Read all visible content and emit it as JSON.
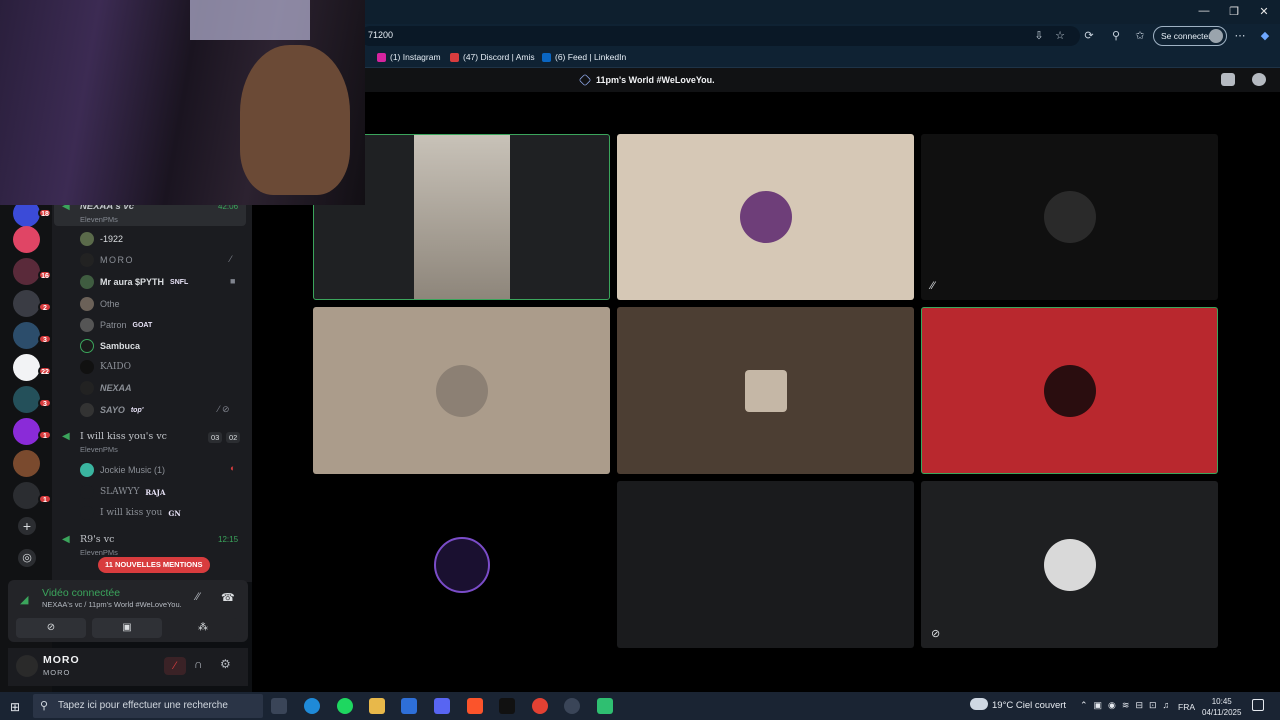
{
  "browser": {
    "url_fragment": "71200",
    "sign_in": "Se connecter",
    "bookmarks": [
      {
        "label": "(1) Instagram",
        "color": "#d6249f"
      },
      {
        "label": "(47) Discord | Amis",
        "color": "#d83c3e"
      },
      {
        "label": "(6) Feed | LinkedIn",
        "color": "#0a66c2"
      }
    ],
    "window_controls": [
      "—",
      "❐",
      "✕"
    ]
  },
  "discord": {
    "server_title": "11pm's World #WeLoveYou.",
    "server_badges": [
      "18",
      "16",
      "2",
      "3",
      "22",
      "3",
      "1",
      "1"
    ],
    "voice_channels": [
      {
        "name": "NEXAA's vc",
        "sub": "ElevenPMs",
        "time": "42:06"
      },
      {
        "name": "I will kiss you's vc",
        "sub": "ElevenPMs",
        "count1": "03",
        "count2": "02"
      },
      {
        "name": "R9's vc",
        "sub": "ElevenPMs",
        "time": "12:15"
      }
    ],
    "members_a": [
      {
        "name": "-1922",
        "dim": false
      },
      {
        "name": "MORO",
        "dim": true
      },
      {
        "name": "Mr aura $PYTH",
        "tag": "SNFL",
        "dim": false
      },
      {
        "name": "Othe",
        "dim": true
      },
      {
        "name": "Patron",
        "tag": "GOAT",
        "dim": true
      },
      {
        "name": "Sambuca",
        "dim": false
      },
      {
        "name": "KAIDO",
        "dim": true
      },
      {
        "name": "NEXAA",
        "dim": true
      },
      {
        "name": "SAYO",
        "tag": "top'",
        "dim": true
      }
    ],
    "members_b": [
      {
        "name": "Jockie Music (1)",
        "dim": true
      },
      {
        "name": "SLAWYY",
        "tag": "RAJA",
        "dim": true
      },
      {
        "name": "I will kiss you",
        "tag": "GN",
        "dim": true
      }
    ],
    "mentions": "11 NOUVELLES MENTIONS",
    "voice_status": "Vidéo connectée",
    "voice_path": "NEXAA's vc / 11pm's World #WeLoveYou.",
    "user": {
      "name": "MORO",
      "status": "MORO"
    }
  },
  "taskbar": {
    "search_placeholder": "Tapez ici pour effectuer une recherche",
    "weather": "19°C  Ciel couvert",
    "lang": "FRA",
    "time": "10:45",
    "date": "04/11/2025"
  }
}
